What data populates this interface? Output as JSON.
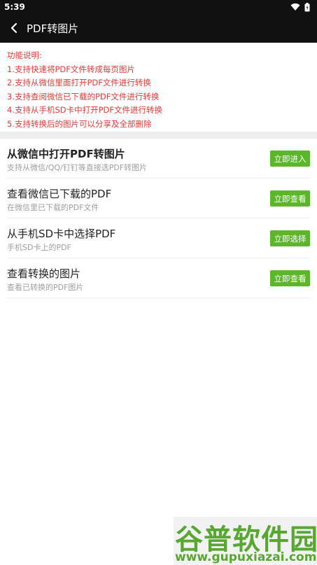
{
  "status_bar": {
    "time": "5:39",
    "icons": [
      "wifi-icon",
      "battery-icon"
    ]
  },
  "app_bar": {
    "back_icon": "chevron-left-icon",
    "title": "PDF转图片"
  },
  "instructions": {
    "heading": "功能说明:",
    "items": [
      "1.支持快速将PDF文件转成每页图片",
      "2.支持从微信里面打开PDF文件进行转换",
      "3.支持查阅微信已下载的PDF文件进行转换",
      "4.支持从手机SD卡中打开PDF文件进行转换",
      "5.支持转换后的图片可以分享及全部删除"
    ],
    "color": "#e53935"
  },
  "options": [
    {
      "title": "从微信中打开PDF转图片",
      "subtitle": "支持从微信/QQ/钉钉等直接选PDF转图片",
      "button": "立即进入"
    },
    {
      "title": "查看微信已下载的PDF",
      "subtitle": "在微信里已下载的PDF文件",
      "button": "立即查看"
    },
    {
      "title": "从手机SD卡中选择PDF",
      "subtitle": "手机SD卡上的PDF",
      "button": "立即选择"
    },
    {
      "title": "查看转换的图片",
      "subtitle": "查看已转换的PDF图片",
      "button": "立即查看"
    }
  ],
  "colors": {
    "accent_green": "#5bb62a",
    "bar_dark": "#111111"
  },
  "watermark": {
    "logo": "谷普软件园",
    "url": "www.gupuxiazai.com"
  }
}
